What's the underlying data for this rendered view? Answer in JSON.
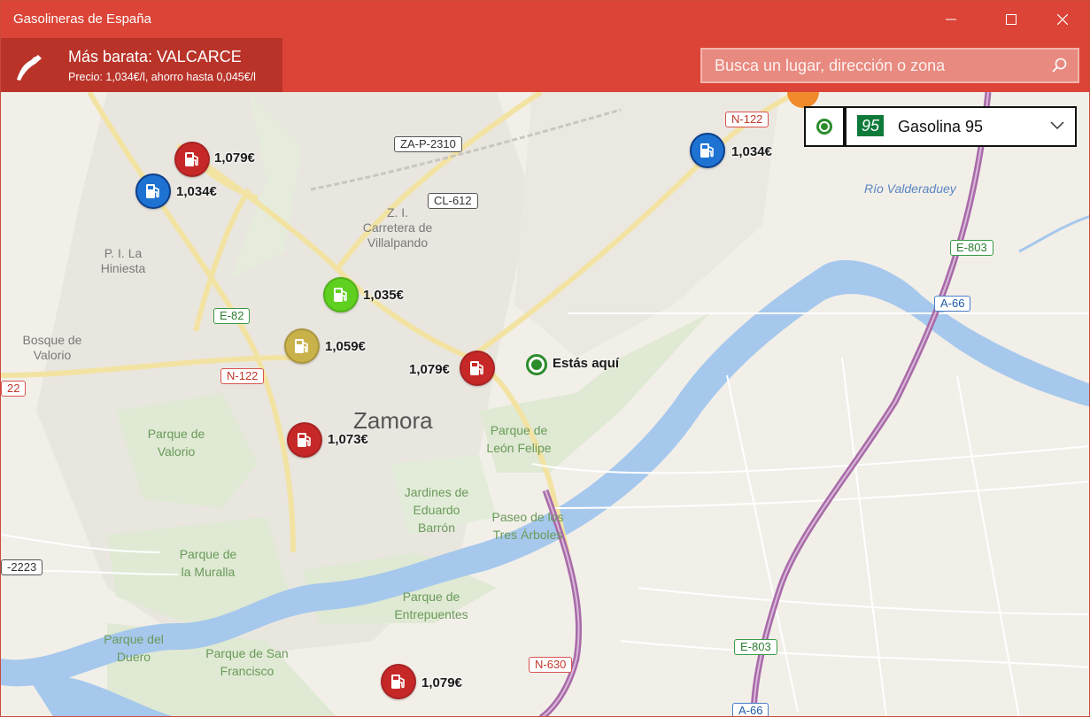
{
  "window": {
    "title": "Gasolineras de España"
  },
  "header": {
    "cheapest_title": "Más barata: VALCARCE",
    "cheapest_sub": "Precio: 1,034€/l, ahorro hasta 0,045€/l",
    "search_placeholder": "Busca un lugar, dirección o zona"
  },
  "fuel_selector": {
    "badge": "95",
    "name": "Gasolina 95"
  },
  "map": {
    "city": "Zamora",
    "you_are_here": "Estás aquí",
    "labels": {
      "zi": "Z. I.\nCarretera de\nVillalpando",
      "pi": "P. I. La\nHiniesta",
      "bosque": "Bosque de\nValorio",
      "parque_valorio": "Parque de\nValorio",
      "parque_leon": "Parque de\nLeón Felipe",
      "jardines": "Jardines de\nEduardo\nBarrón",
      "paseo": "Paseo de los\nTres Árboles",
      "muralla": "Parque de\nla Muralla",
      "entrepuentes": "Parque de\nEntrepuentes",
      "duero": "Parque del\nDuero",
      "san_francisco": "Parque de San\nFrancisco",
      "rio": "Río Valderaduey"
    },
    "shields": {
      "zap": "ZA-P-2310",
      "cl612": "CL-612",
      "n122_top": "N-122",
      "n122_mid": "N-122",
      "n122_left": "22",
      "e82": "E-82",
      "e803_top": "E-803",
      "a66_top": "A-66",
      "za2223": "-2223",
      "e803_bottom": "E-803",
      "n630": "N-630",
      "a66_bottom": "A-66"
    },
    "stations": [
      {
        "price": "1,079€",
        "color": "#c62828"
      },
      {
        "price": "1,034€",
        "color": "#1e73d2"
      },
      {
        "price": "1,035€",
        "color": "#5fd01f"
      },
      {
        "price": "1,059€",
        "color": "#c9b24a"
      },
      {
        "price": "1,079€",
        "color": "#c62828"
      },
      {
        "price": "1,073€",
        "color": "#c62828"
      },
      {
        "price": "1,079€",
        "color": "#c62828"
      },
      {
        "price": "1,034€",
        "color": "#1e73d2"
      }
    ]
  }
}
